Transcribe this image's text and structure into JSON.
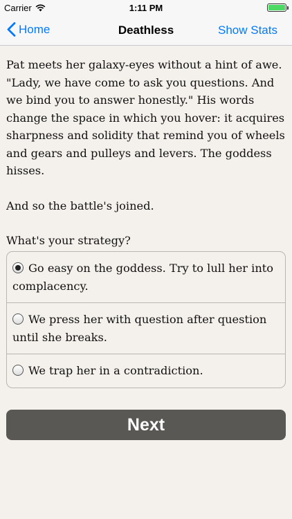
{
  "status_bar": {
    "carrier": "Carrier",
    "time": "1:11 PM"
  },
  "nav": {
    "back_label": "Home",
    "title": "Deathless",
    "right_label": "Show Stats"
  },
  "story": {
    "paragraphs": [
      "Pat meets her galaxy-eyes without a hint of awe. \"Lady, we have come to ask you questions. And we bind you to answer honestly.\" His words change the space in which you hover: it acquires sharpness and solidity that remind you of wheels and gears and pulleys and levers. The goddess hisses.",
      "And so the battle's joined.",
      "What's your strategy?"
    ]
  },
  "choices": {
    "selected_index": 0,
    "items": [
      "Go easy on the goddess. Try to lull her into complacency.",
      "We press her with question after question until she breaks.",
      "We trap her in a contradiction."
    ]
  },
  "next_label": "Next",
  "colors": {
    "accent": "#007aff",
    "background": "#f4f1ec",
    "button": "#5a5855",
    "battery": "#4cd964"
  }
}
